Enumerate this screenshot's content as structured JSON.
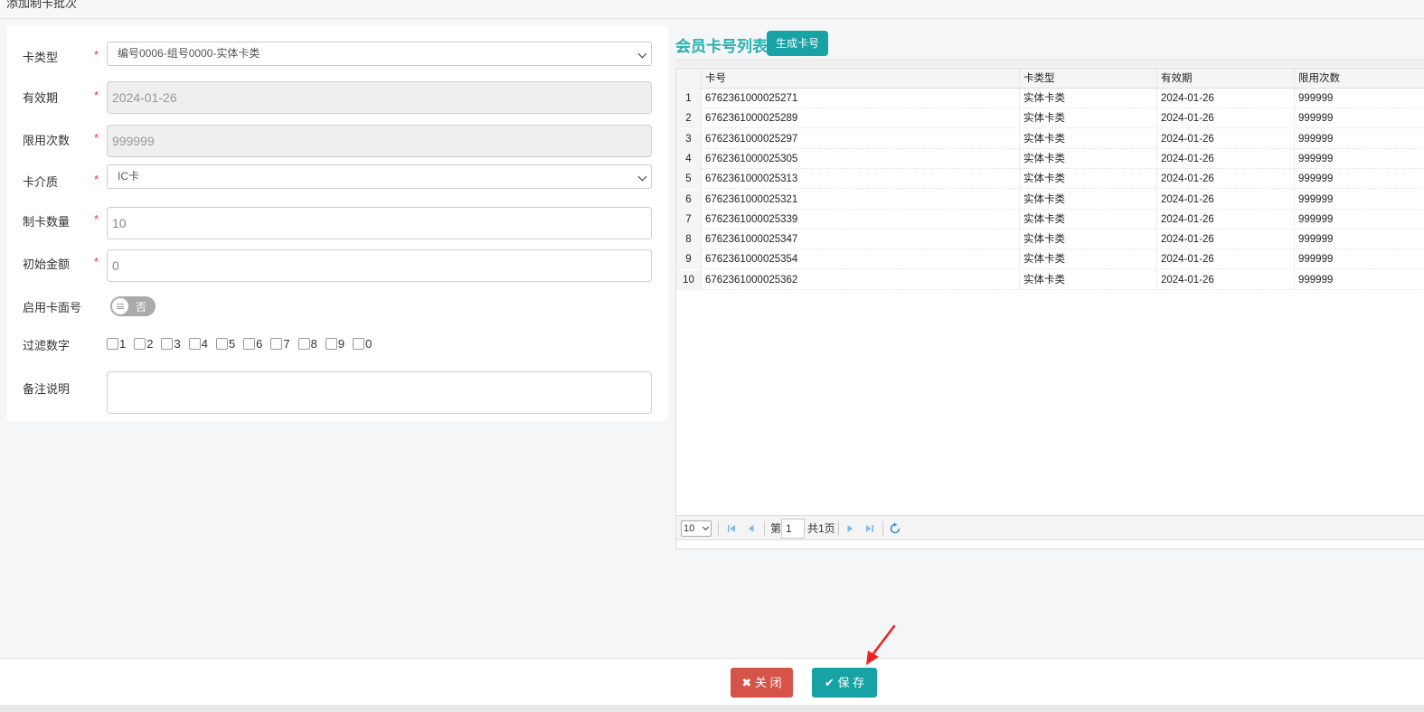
{
  "window_title": "添加制卡批次",
  "form": {
    "card_type": {
      "label": "卡类型",
      "value": "编号0006-组号0000-实体卡类"
    },
    "expiry": {
      "label": "有效期",
      "value": "2024-01-26"
    },
    "limit": {
      "label": "限用次数",
      "value": "999999"
    },
    "medium": {
      "label": "卡介质",
      "value": "IC卡"
    },
    "quantity": {
      "label": "制卡数量",
      "value": "10"
    },
    "initial_amount": {
      "label": "初始金额",
      "value": "0"
    },
    "enable_face_no": {
      "label": "启用卡面号",
      "toggle_text": "否",
      "on": false
    },
    "filter_digits": {
      "label": "过滤数字",
      "digits": [
        "1",
        "2",
        "3",
        "4",
        "5",
        "6",
        "7",
        "8",
        "9",
        "0"
      ]
    },
    "remark": {
      "label": "备注说明",
      "value": ""
    },
    "required_mark": "*"
  },
  "list": {
    "title": "会员卡号列表",
    "generate_button": "生成卡号",
    "columns": [
      "卡号",
      "卡类型",
      "有效期",
      "限用次数"
    ],
    "rows": [
      {
        "n": "1",
        "card": "6762361000025271",
        "type": "实体卡类",
        "expiry": "2024-01-26",
        "limit": "999999"
      },
      {
        "n": "2",
        "card": "6762361000025289",
        "type": "实体卡类",
        "expiry": "2024-01-26",
        "limit": "999999"
      },
      {
        "n": "3",
        "card": "6762361000025297",
        "type": "实体卡类",
        "expiry": "2024-01-26",
        "limit": "999999"
      },
      {
        "n": "4",
        "card": "6762361000025305",
        "type": "实体卡类",
        "expiry": "2024-01-26",
        "limit": "999999"
      },
      {
        "n": "5",
        "card": "6762361000025313",
        "type": "实体卡类",
        "expiry": "2024-01-26",
        "limit": "999999"
      },
      {
        "n": "6",
        "card": "6762361000025321",
        "type": "实体卡类",
        "expiry": "2024-01-26",
        "limit": "999999"
      },
      {
        "n": "7",
        "card": "6762361000025339",
        "type": "实体卡类",
        "expiry": "2024-01-26",
        "limit": "999999"
      },
      {
        "n": "8",
        "card": "6762361000025347",
        "type": "实体卡类",
        "expiry": "2024-01-26",
        "limit": "999999"
      },
      {
        "n": "9",
        "card": "6762361000025354",
        "type": "实体卡类",
        "expiry": "2024-01-26",
        "limit": "999999"
      },
      {
        "n": "10",
        "card": "6762361000025362",
        "type": "实体卡类",
        "expiry": "2024-01-26",
        "limit": "999999"
      }
    ],
    "pager": {
      "page_size": "10",
      "page_prefix": "第",
      "page": "1",
      "total_text": "共1页"
    }
  },
  "footer": {
    "close_label": "关 闭",
    "save_label": "保 存"
  },
  "colors": {
    "accent": "#17a2a5",
    "danger": "#d6534a",
    "required": "#e33333",
    "annotation_arrow": "#ee2222"
  }
}
